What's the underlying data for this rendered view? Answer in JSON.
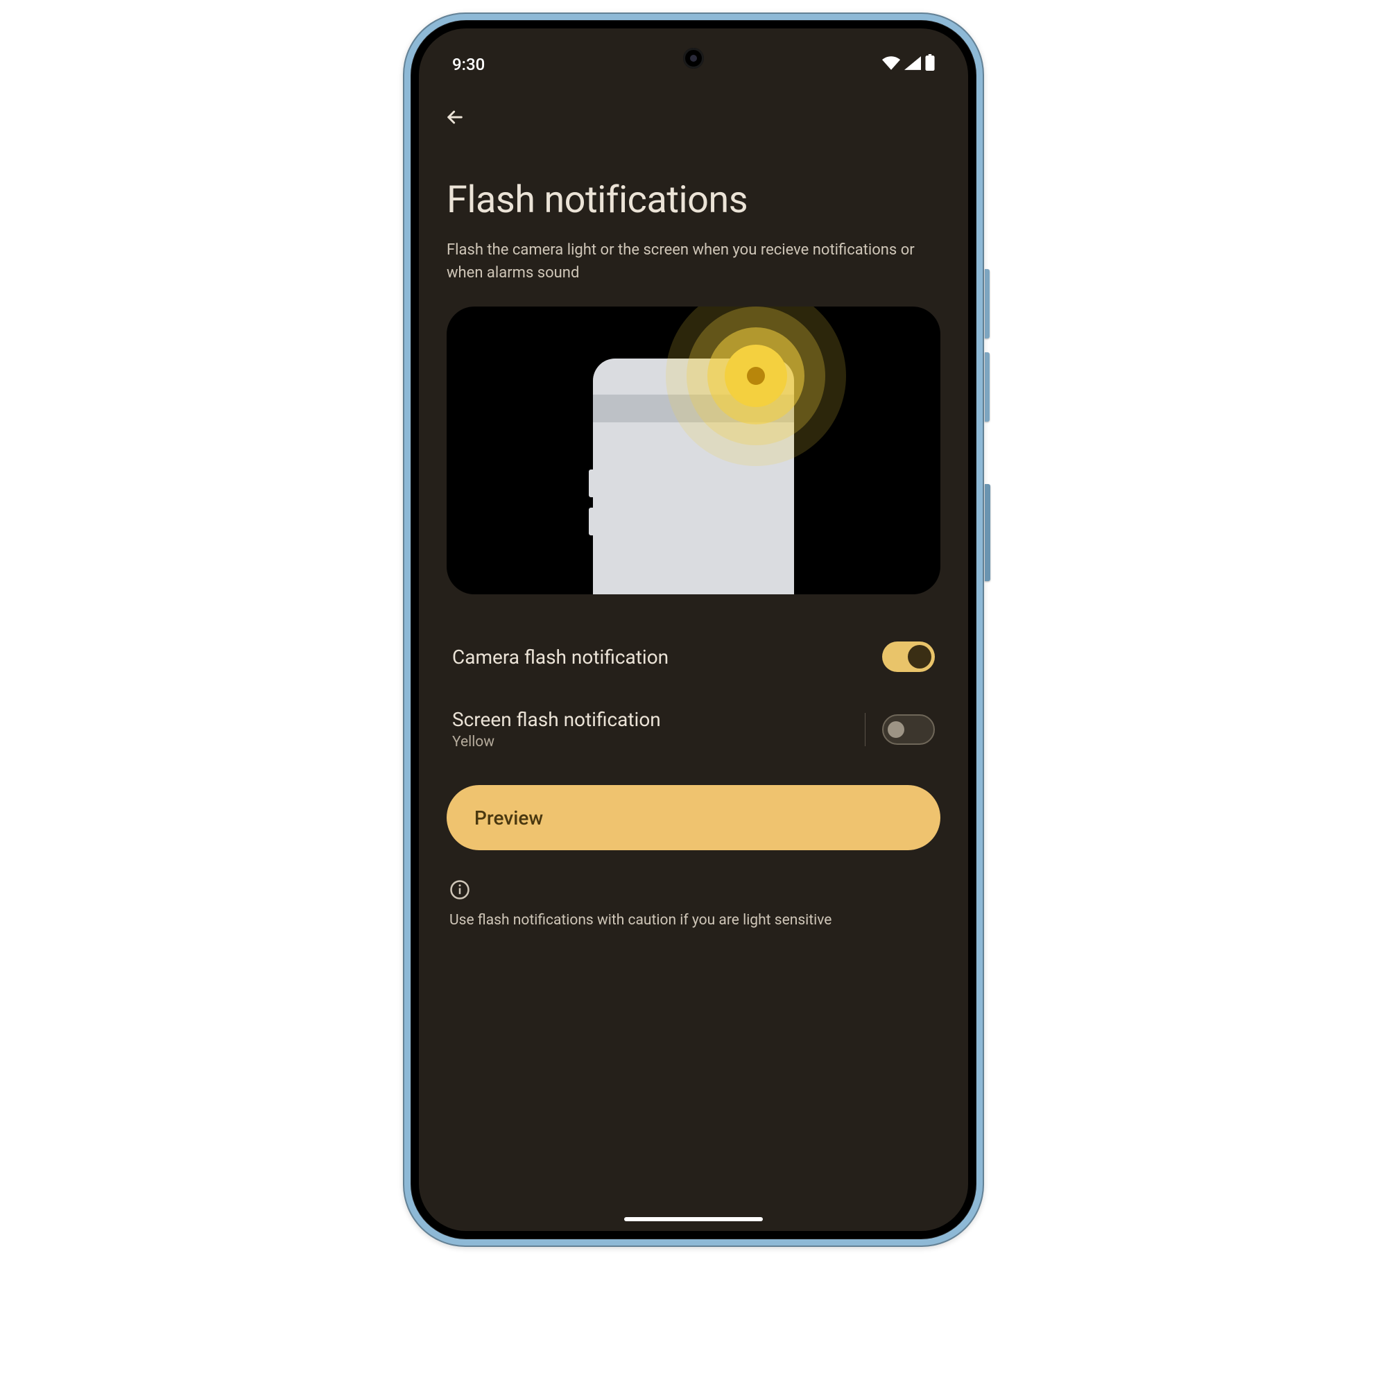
{
  "status": {
    "time": "9:30"
  },
  "page": {
    "title": "Flash notifications",
    "subtitle": "Flash the camera light or the screen when you recieve notifications or when alarms sound"
  },
  "settings": {
    "camera": {
      "label": "Camera flash notification",
      "enabled": true
    },
    "screen": {
      "label": "Screen flash notification",
      "sub": "Yellow",
      "enabled": false
    }
  },
  "preview_label": "Preview",
  "caution": "Use flash notifications with caution if you are light sensitive",
  "colors": {
    "accent": "#efc36f",
    "bg": "#25201a",
    "text": "#ebe3d7"
  }
}
